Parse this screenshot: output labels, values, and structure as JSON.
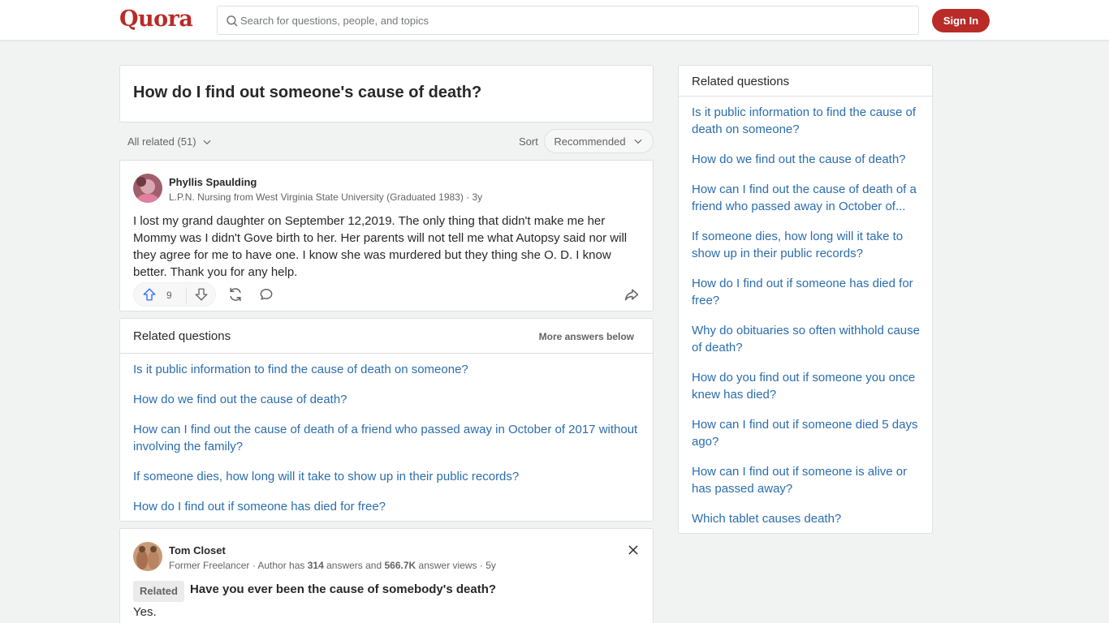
{
  "header": {
    "logo": "Quora",
    "search_placeholder": "Search for questions, people, and topics",
    "signin_label": "Sign In"
  },
  "question": {
    "title": "How do I find out someone's cause of death?"
  },
  "filters": {
    "all_related": "All related (51)",
    "sort_label": "Sort",
    "sort_value": "Recommended"
  },
  "answer1": {
    "author": "Phyllis Spaulding",
    "credential": "L.P.N. Nursing from West Virginia State University (Graduated 1983) · 3y",
    "body": "I lost my grand daughter on September 12,2019. The only thing that didn't make me her Mommy was I didn't Gove birth to her. Her parents will not tell me what Autopsy said nor will they agree for me to have one. I know she was murdered but they thing she O. D. I know better. Thank you for any help.",
    "upvotes": "9"
  },
  "related_inline": {
    "title": "Related questions",
    "more": "More answers below",
    "items": [
      "Is it public information to find the cause of death on someone?",
      "How do we find out the cause of death?",
      "How can I find out the cause of death of a friend who passed away in October of 2017 without involving the family?",
      "If someone dies, how long will it take to show up in their public records?",
      "How do I find out if someone has died for free?"
    ]
  },
  "answer2": {
    "author": "Tom Closet",
    "cred_prefix": "Former Freelancer · Author has ",
    "answers_count": "314",
    "cred_mid": " answers and ",
    "views_count": "566.7K",
    "cred_suffix": " answer views · 5y",
    "related_tag": "Related",
    "related_question": "Have you ever been the cause of somebody's death?",
    "body": "Yes."
  },
  "sidebar": {
    "title": "Related questions",
    "items": [
      "Is it public information to find the cause of death on someone?",
      "How do we find out the cause of death?",
      "How can I find out the cause of death of a friend who passed away in October of...",
      "If someone dies, how long will it take to show up in their public records?",
      "How do I find out if someone has died for free?",
      "Why do obituaries so often withhold cause of death?",
      "How do you find out if someone you once knew has died?",
      "How can I find out if someone died 5 days ago?",
      "How can I find out if someone is alive or has passed away?",
      "Which tablet causes death?"
    ]
  },
  "colors": {
    "brand": "#b92b27",
    "link": "#2b6dad",
    "upvote": "#2e69ff"
  }
}
